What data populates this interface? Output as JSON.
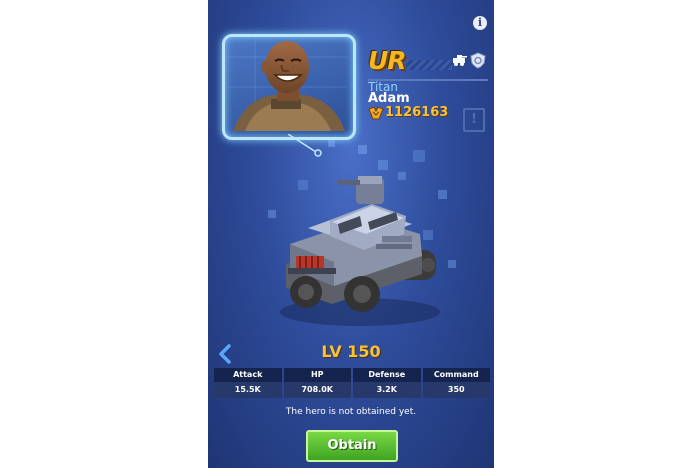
{
  "hero": {
    "rarity": "UR",
    "class": "Titan",
    "name": "Adam",
    "power": "1126163",
    "level": "LV 150"
  },
  "stats": [
    {
      "label": "Attack",
      "value": "15.5K"
    },
    {
      "label": "HP",
      "value": "708.0K"
    },
    {
      "label": "Defense",
      "value": "3.2K"
    },
    {
      "label": "Command",
      "value": "350"
    }
  ],
  "notice": "The hero is not obtained yet.",
  "buttons": {
    "obtain": "Obtain",
    "info": "i",
    "report": "!"
  },
  "icons": [
    "info-icon",
    "vehicle-type-icon",
    "shield-icon",
    "power-icon",
    "report-icon",
    "arrow-left-icon"
  ],
  "colors": {
    "panel": "#2f4d9c",
    "gold": "#f8c13a",
    "button": "#4fba2e",
    "class_text": "#8fd2ff"
  }
}
